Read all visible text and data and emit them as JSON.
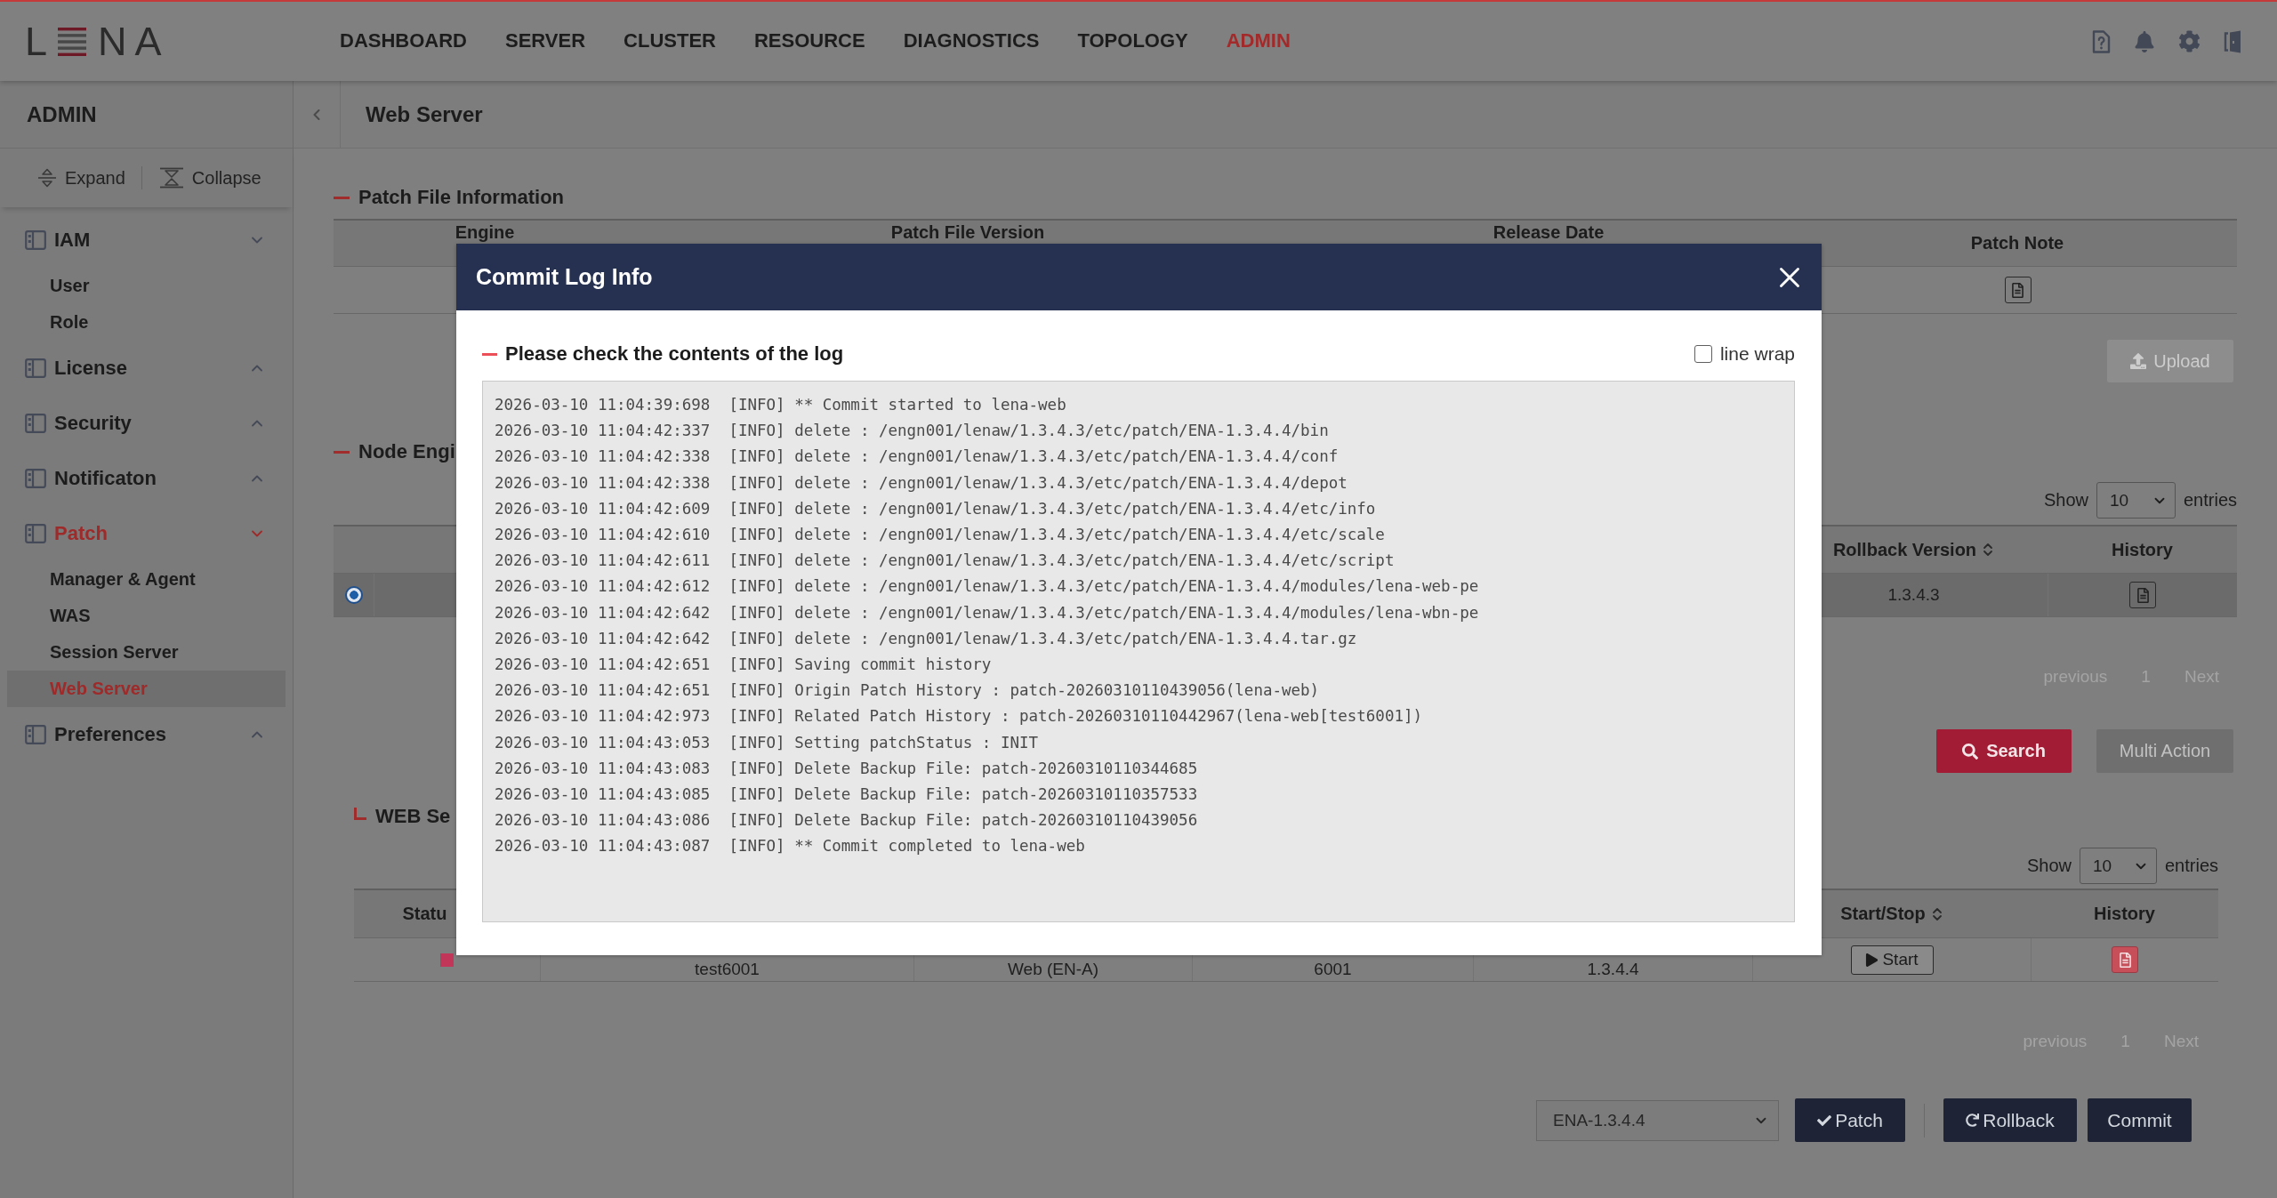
{
  "nav": {
    "logo": {
      "start": "L",
      "end": "NA"
    },
    "items": [
      {
        "label": "DASHBOARD",
        "selected": false
      },
      {
        "label": "SERVER",
        "selected": false
      },
      {
        "label": "CLUSTER",
        "selected": false
      },
      {
        "label": "RESOURCE",
        "selected": false
      },
      {
        "label": "DIAGNOSTICS",
        "selected": false
      },
      {
        "label": "TOPOLOGY",
        "selected": false
      },
      {
        "label": "ADMIN",
        "selected": true
      }
    ]
  },
  "sidebar": {
    "title": "ADMIN",
    "expand": "Expand",
    "collapse": "Collapse",
    "groups": [
      {
        "label": "IAM",
        "selected": false,
        "expanded": true,
        "children": [
          {
            "label": "User",
            "selected": false
          },
          {
            "label": "Role",
            "selected": false
          }
        ]
      },
      {
        "label": "License",
        "selected": false,
        "expanded": false
      },
      {
        "label": "Security",
        "selected": false,
        "expanded": false
      },
      {
        "label": "Notificaton",
        "selected": false,
        "expanded": false
      },
      {
        "label": "Patch",
        "selected": true,
        "expanded": true,
        "children": [
          {
            "label": "Manager & Agent",
            "selected": false
          },
          {
            "label": "WAS",
            "selected": false
          },
          {
            "label": "Session Server",
            "selected": false
          },
          {
            "label": "Web Server",
            "selected": true
          }
        ]
      },
      {
        "label": "Preferences",
        "selected": false,
        "expanded": false
      }
    ]
  },
  "breadcrumb": {
    "title": "Web Server"
  },
  "patch_file": {
    "title": "Patch File Information",
    "columns": [
      "Engine",
      "Patch File Version",
      "Release Date",
      "Patch Note"
    ],
    "rows": [
      {
        "note_highlighted": false
      }
    ],
    "upload": {
      "label": "Upload",
      "disabled": true
    }
  },
  "node_engine": {
    "title": "Node Engi",
    "show": "Show",
    "page_size": "10",
    "entries": "entries",
    "columns": [
      {
        "label": "Rollback Version",
        "sortable": true
      },
      {
        "label": "History",
        "sortable": false
      }
    ],
    "rows": [
      {
        "selected": true,
        "rollback_version": "1.3.4.3",
        "history_highlighted": false
      }
    ],
    "pagination": {
      "previous": {
        "label": "previous",
        "disabled": true
      },
      "pages": [
        "1"
      ],
      "next": {
        "label": "Next",
        "disabled": true
      }
    },
    "search": "Search",
    "multi_action": {
      "label": "Multi Action",
      "disabled": true
    }
  },
  "web_server": {
    "title": "WEB Se",
    "show": "Show",
    "page_size": "10",
    "entries": "entries",
    "columns": [
      {
        "label": "Statu",
        "sortable": false
      },
      {
        "label": "Start/Stop",
        "sortable": true
      },
      {
        "label": "History",
        "sortable": false
      }
    ],
    "rows": [
      {
        "color": "#c2365a",
        "name": "test6001",
        "type": "Web (EN-A)",
        "port": "6001",
        "version": "1.3.4.4",
        "action": "Start",
        "history_highlighted": true
      }
    ],
    "pagination": {
      "previous": {
        "label": "previous",
        "disabled": true
      },
      "pages": [
        "1"
      ],
      "next": {
        "label": "Next",
        "disabled": true
      }
    }
  },
  "actions": {
    "version": "ENA-1.3.4.4",
    "patch": "Patch",
    "rollback": "Rollback",
    "commit": "Commit"
  },
  "modal": {
    "title": "Commit Log Info",
    "subtitle": "Please check the contents of the log",
    "line_wrap": {
      "label": "line wrap",
      "checked": false
    },
    "log": [
      "2026-03-10 11:04:39:698  [INFO] ** Commit started to lena-web",
      "2026-03-10 11:04:42:337  [INFO] delete : /engn001/lenaw/1.3.4.3/etc/patch/ENA-1.3.4.4/bin",
      "2026-03-10 11:04:42:338  [INFO] delete : /engn001/lenaw/1.3.4.3/etc/patch/ENA-1.3.4.4/conf",
      "2026-03-10 11:04:42:338  [INFO] delete : /engn001/lenaw/1.3.4.3/etc/patch/ENA-1.3.4.4/depot",
      "2026-03-10 11:04:42:609  [INFO] delete : /engn001/lenaw/1.3.4.3/etc/patch/ENA-1.3.4.4/etc/info",
      "2026-03-10 11:04:42:610  [INFO] delete : /engn001/lenaw/1.3.4.3/etc/patch/ENA-1.3.4.4/etc/scale",
      "2026-03-10 11:04:42:611  [INFO] delete : /engn001/lenaw/1.3.4.3/etc/patch/ENA-1.3.4.4/etc/script",
      "2026-03-10 11:04:42:612  [INFO] delete : /engn001/lenaw/1.3.4.3/etc/patch/ENA-1.3.4.4/modules/lena-web-pe",
      "2026-03-10 11:04:42:642  [INFO] delete : /engn001/lenaw/1.3.4.3/etc/patch/ENA-1.3.4.4/modules/lena-wbn-pe",
      "2026-03-10 11:04:42:642  [INFO] delete : /engn001/lenaw/1.3.4.3/etc/patch/ENA-1.3.4.4.tar.gz",
      "2026-03-10 11:04:42:651  [INFO] Saving commit history",
      "2026-03-10 11:04:42:651  [INFO] Origin Patch History : patch-20260310110439056(lena-web)",
      "2026-03-10 11:04:42:973  [INFO] Related Patch History : patch-20260310110442967(lena-web[test6001])",
      "2026-03-10 11:04:43:053  [INFO] Setting patchStatus : INIT",
      "2026-03-10 11:04:43:083  [INFO] Delete Backup File: patch-20260310110344685",
      "2026-03-10 11:04:43:085  [INFO] Delete Backup File: patch-20260310110357533",
      "2026-03-10 11:04:43:086  [INFO] Delete Backup File: patch-20260310110439056",
      "2026-03-10 11:04:43:087  [INFO] ** Commit completed to lena-web"
    ]
  }
}
